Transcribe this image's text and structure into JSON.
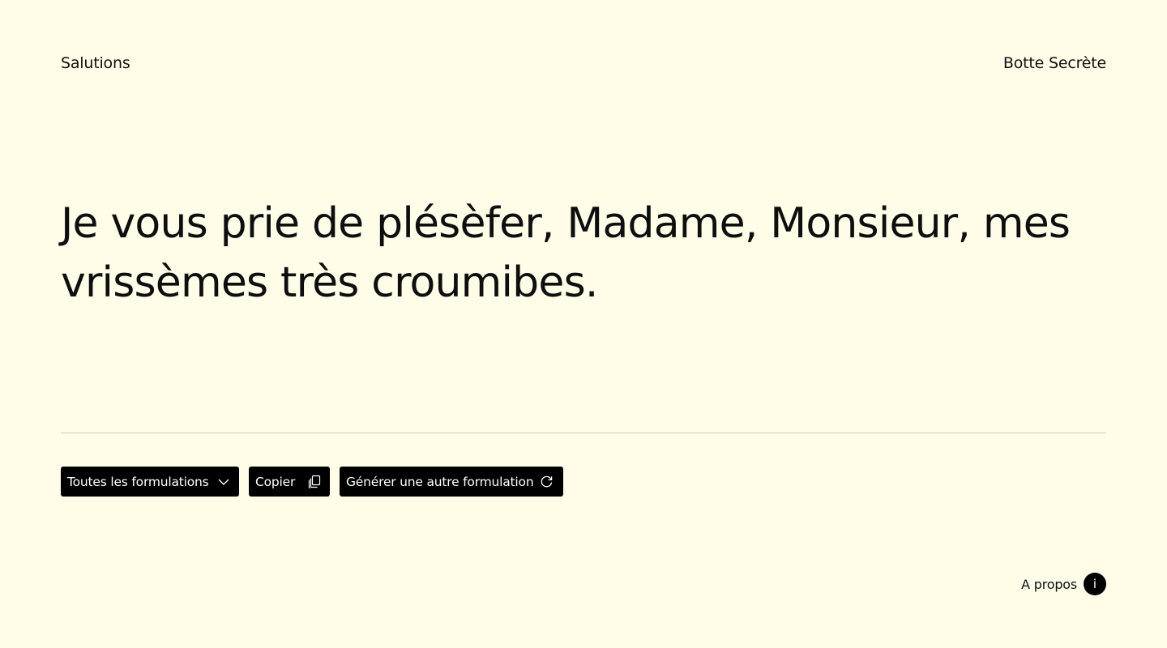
{
  "header": {
    "brand": "Salutions",
    "secret_link": "Botte Secrète"
  },
  "main": {
    "salutation": "Je vous prie de plésèfer, Madame, Monsieur, mes vrissèmes très croumibes."
  },
  "actions": {
    "formulations_label": "Toutes les formulations",
    "formulations_icon": "chevron-down-icon",
    "copy_label": "Copier",
    "copy_icon": "copy-icon",
    "generate_label": "Générer une autre formulation",
    "generate_icon": "refresh-icon"
  },
  "footer": {
    "about_label": "A propos",
    "info_glyph": "i"
  },
  "colors": {
    "background": "#fffce8",
    "text": "#111111",
    "button_bg": "#000000",
    "button_text": "#ffffff",
    "divider": "#cfcdbd"
  }
}
